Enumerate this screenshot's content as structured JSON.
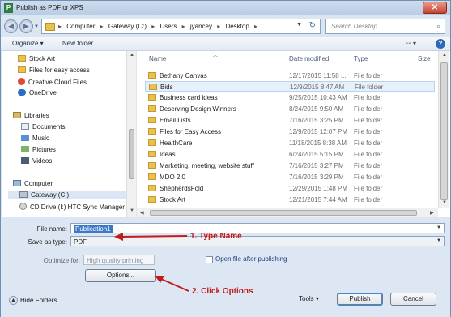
{
  "window": {
    "title": "Publish as PDF or XPS",
    "app_icon": "P",
    "close_glyph": "✕"
  },
  "address_bar": {
    "crumbs": [
      "Computer",
      "Gateway (C:)",
      "Users",
      "jyancey",
      "Desktop"
    ],
    "separator": "▸"
  },
  "search": {
    "placeholder": "Search Desktop"
  },
  "toolbar": {
    "organize_label": "Organize ▾",
    "new_folder_label": "New folder",
    "help": "?"
  },
  "nav_pane": {
    "items": [
      {
        "label": "Stock Art",
        "icon": "folder-icon"
      },
      {
        "label": "Files for easy access",
        "icon": "folder-icon"
      },
      {
        "label": "Creative Cloud Files",
        "icon": "creative-cloud-icon"
      },
      {
        "label": "OneDrive",
        "icon": "cloud-icon"
      },
      {
        "label": "Libraries",
        "icon": "libraries-icon"
      },
      {
        "label": "Documents",
        "icon": "documents-icon"
      },
      {
        "label": "Music",
        "icon": "music-icon"
      },
      {
        "label": "Pictures",
        "icon": "pictures-icon"
      },
      {
        "label": "Videos",
        "icon": "videos-icon"
      },
      {
        "label": "Computer",
        "icon": "computer-icon"
      },
      {
        "label": "Gateway (C:)",
        "icon": "drive-icon"
      },
      {
        "label": "CD Drive (I:) HTC Sync Manager",
        "icon": "cd-drive-icon"
      }
    ]
  },
  "file_list": {
    "columns": {
      "name": "Name",
      "date": "Date modified",
      "type": "Type",
      "size": "Size"
    },
    "rows": [
      {
        "name": "Bethany Canvas",
        "date": "12/17/2015 11:58 ...",
        "type": "File folder"
      },
      {
        "name": "Bids",
        "date": "12/9/2015 8:47 AM",
        "type": "File folder"
      },
      {
        "name": "Business card ideas",
        "date": "9/25/2015 10:43 AM",
        "type": "File folder"
      },
      {
        "name": "Deserving Design Winners",
        "date": "8/24/2015 9:50 AM",
        "type": "File folder"
      },
      {
        "name": "Email Lists",
        "date": "7/16/2015 3:25 PM",
        "type": "File folder"
      },
      {
        "name": "Files for Easy Access",
        "date": "12/9/2015 12:07 PM",
        "type": "File folder"
      },
      {
        "name": "HealthCare",
        "date": "11/18/2015 8:38 AM",
        "type": "File folder"
      },
      {
        "name": "Ideas",
        "date": "6/24/2015 5:15 PM",
        "type": "File folder"
      },
      {
        "name": "Marketing, meeting, website stuff",
        "date": "7/16/2015 3:27 PM",
        "type": "File folder"
      },
      {
        "name": "MDO 2.0",
        "date": "7/16/2015 3:29 PM",
        "type": "File folder"
      },
      {
        "name": "ShepherdsFold",
        "date": "12/29/2015 1:48 PM",
        "type": "File folder"
      },
      {
        "name": "Stock Art",
        "date": "12/21/2015 7:44 AM",
        "type": "File folder"
      }
    ]
  },
  "form": {
    "file_name_label": "File name:",
    "file_name_value": "Publication1",
    "save_type_label": "Save as type:",
    "save_type_value": "PDF",
    "optimize_label": "Optimize for:",
    "optimize_value": "High quality printing",
    "open_after_label": "Open file after publishing",
    "options_label": "Options...",
    "hide_folders_label": "Hide Folders",
    "tools_label": "Tools",
    "publish_label": "Publish",
    "cancel_label": "Cancel"
  },
  "annotations": {
    "step1": "1. Type Name",
    "step2": "2. Click Options",
    "color": "#c61a1a"
  }
}
